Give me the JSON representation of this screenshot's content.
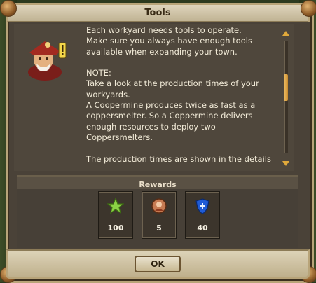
{
  "dialog": {
    "title": "Tools",
    "ok_label": "OK"
  },
  "message": {
    "lines": [
      "Each workyard needs tools to operate.",
      "Make sure you always have enough tools",
      "available when expanding your town.",
      "",
      "NOTE:",
      "Take a look at the production times of your",
      "workyards.",
      "A Coopermine produces twice as fast as a",
      "coppersmelter. So a Coppermine delivers",
      "enough resources to deploy two",
      "Coppersmelters.",
      "",
      "The production times are shown in the details"
    ]
  },
  "rewards": {
    "title": "Rewards",
    "items": [
      {
        "icon": "star-icon",
        "value": "100"
      },
      {
        "icon": "coin-portrait-icon",
        "value": "5"
      },
      {
        "icon": "blue-shield-icon",
        "value": "40"
      }
    ]
  },
  "colors": {
    "accent": "#e0a93b",
    "panel": "#4f473c",
    "text": "#f1ead7"
  }
}
